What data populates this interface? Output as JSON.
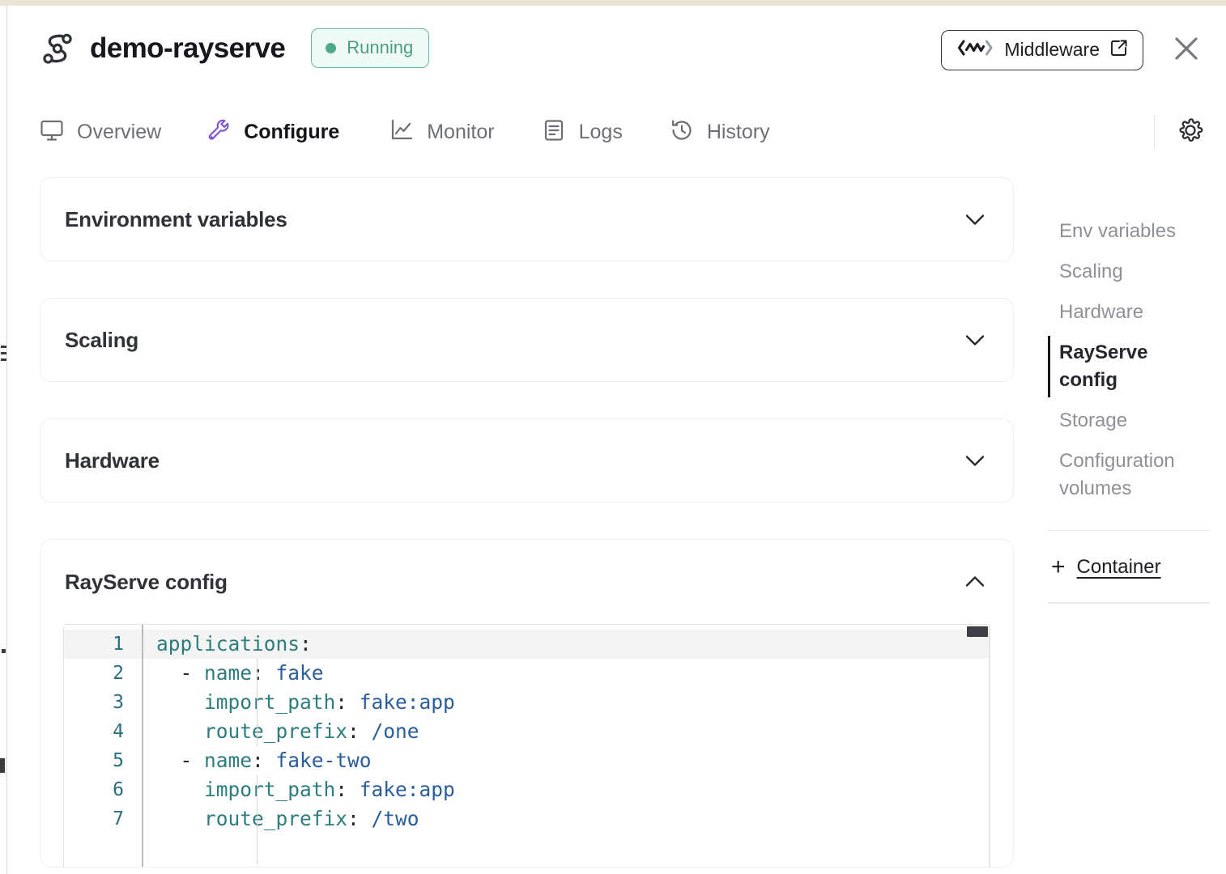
{
  "header": {
    "logo_icon": "anyscale-logo-icon",
    "title": "demo-rayserve",
    "status": {
      "label": "Running",
      "dot_color": "#4eab89",
      "text_color": "#4a9e81",
      "border_color": "#63b99b",
      "bg_color": "#f0faf6"
    },
    "middleware_button": {
      "label": "Middleware",
      "icon": "middleware-logo-icon",
      "external_icon": "external-link-icon"
    },
    "close_icon": "close-icon"
  },
  "tabs": [
    {
      "label": "Overview",
      "icon": "monitor-icon",
      "active": false
    },
    {
      "label": "Configure",
      "icon": "wrench-icon",
      "active": true
    },
    {
      "label": "Monitor",
      "icon": "line-chart-icon",
      "active": false
    },
    {
      "label": "Logs",
      "icon": "document-lines-icon",
      "active": false
    },
    {
      "label": "History",
      "icon": "clock-history-icon",
      "active": false
    }
  ],
  "tabs_right": {
    "settings_icon": "gear-icon"
  },
  "sections": [
    {
      "title": "Environment variables",
      "expanded": false,
      "chevron": "chevron-down-icon"
    },
    {
      "title": "Scaling",
      "expanded": false,
      "chevron": "chevron-down-icon"
    },
    {
      "title": "Hardware",
      "expanded": false,
      "chevron": "chevron-down-icon"
    },
    {
      "title": "RayServe config",
      "expanded": true,
      "chevron": "chevron-up-icon"
    }
  ],
  "editor": {
    "language": "yaml",
    "lines": [
      {
        "num": "1",
        "current": true,
        "tokens": [
          {
            "t": "applications",
            "c": "key"
          },
          {
            "t": ":",
            "c": "punc"
          }
        ]
      },
      {
        "num": "2",
        "current": false,
        "tokens": [
          {
            "t": "  - ",
            "c": "dash"
          },
          {
            "t": "name",
            "c": "key"
          },
          {
            "t": ": ",
            "c": "punc"
          },
          {
            "t": "fake",
            "c": "val"
          }
        ]
      },
      {
        "num": "3",
        "current": false,
        "tokens": [
          {
            "t": "    ",
            "c": "punc"
          },
          {
            "t": "import_path",
            "c": "key"
          },
          {
            "t": ": ",
            "c": "punc"
          },
          {
            "t": "fake:app",
            "c": "val"
          }
        ]
      },
      {
        "num": "4",
        "current": false,
        "tokens": [
          {
            "t": "    ",
            "c": "punc"
          },
          {
            "t": "route_prefix",
            "c": "key"
          },
          {
            "t": ": ",
            "c": "punc"
          },
          {
            "t": "/one",
            "c": "val"
          }
        ]
      },
      {
        "num": "5",
        "current": false,
        "tokens": [
          {
            "t": "  - ",
            "c": "dash"
          },
          {
            "t": "name",
            "c": "key"
          },
          {
            "t": ": ",
            "c": "punc"
          },
          {
            "t": "fake-two",
            "c": "val"
          }
        ]
      },
      {
        "num": "6",
        "current": false,
        "tokens": [
          {
            "t": "    ",
            "c": "punc"
          },
          {
            "t": "import_path",
            "c": "key"
          },
          {
            "t": ": ",
            "c": "punc"
          },
          {
            "t": "fake:app",
            "c": "val"
          }
        ]
      },
      {
        "num": "7",
        "current": false,
        "tokens": [
          {
            "t": "    ",
            "c": "punc"
          },
          {
            "t": "route_prefix",
            "c": "key"
          },
          {
            "t": ": ",
            "c": "punc"
          },
          {
            "t": "/two",
            "c": "val"
          }
        ]
      }
    ],
    "colors": {
      "key": "#2e7d7d",
      "value": "#2a5d9c",
      "punctuation": "#23272b",
      "line_number": "#2a6f80",
      "current_line_bg": "#f4f4f4"
    }
  },
  "sidebar": {
    "items": [
      {
        "label": "Env variables",
        "active": false
      },
      {
        "label": "Scaling",
        "active": false
      },
      {
        "label": "Hardware",
        "active": false
      },
      {
        "label": "RayServe config",
        "active": true
      },
      {
        "label": "Storage",
        "active": false
      },
      {
        "label": "Configuration volumes",
        "active": false
      }
    ],
    "add_container": {
      "plus": "+",
      "label": "Container",
      "icon": "plus-icon"
    }
  }
}
